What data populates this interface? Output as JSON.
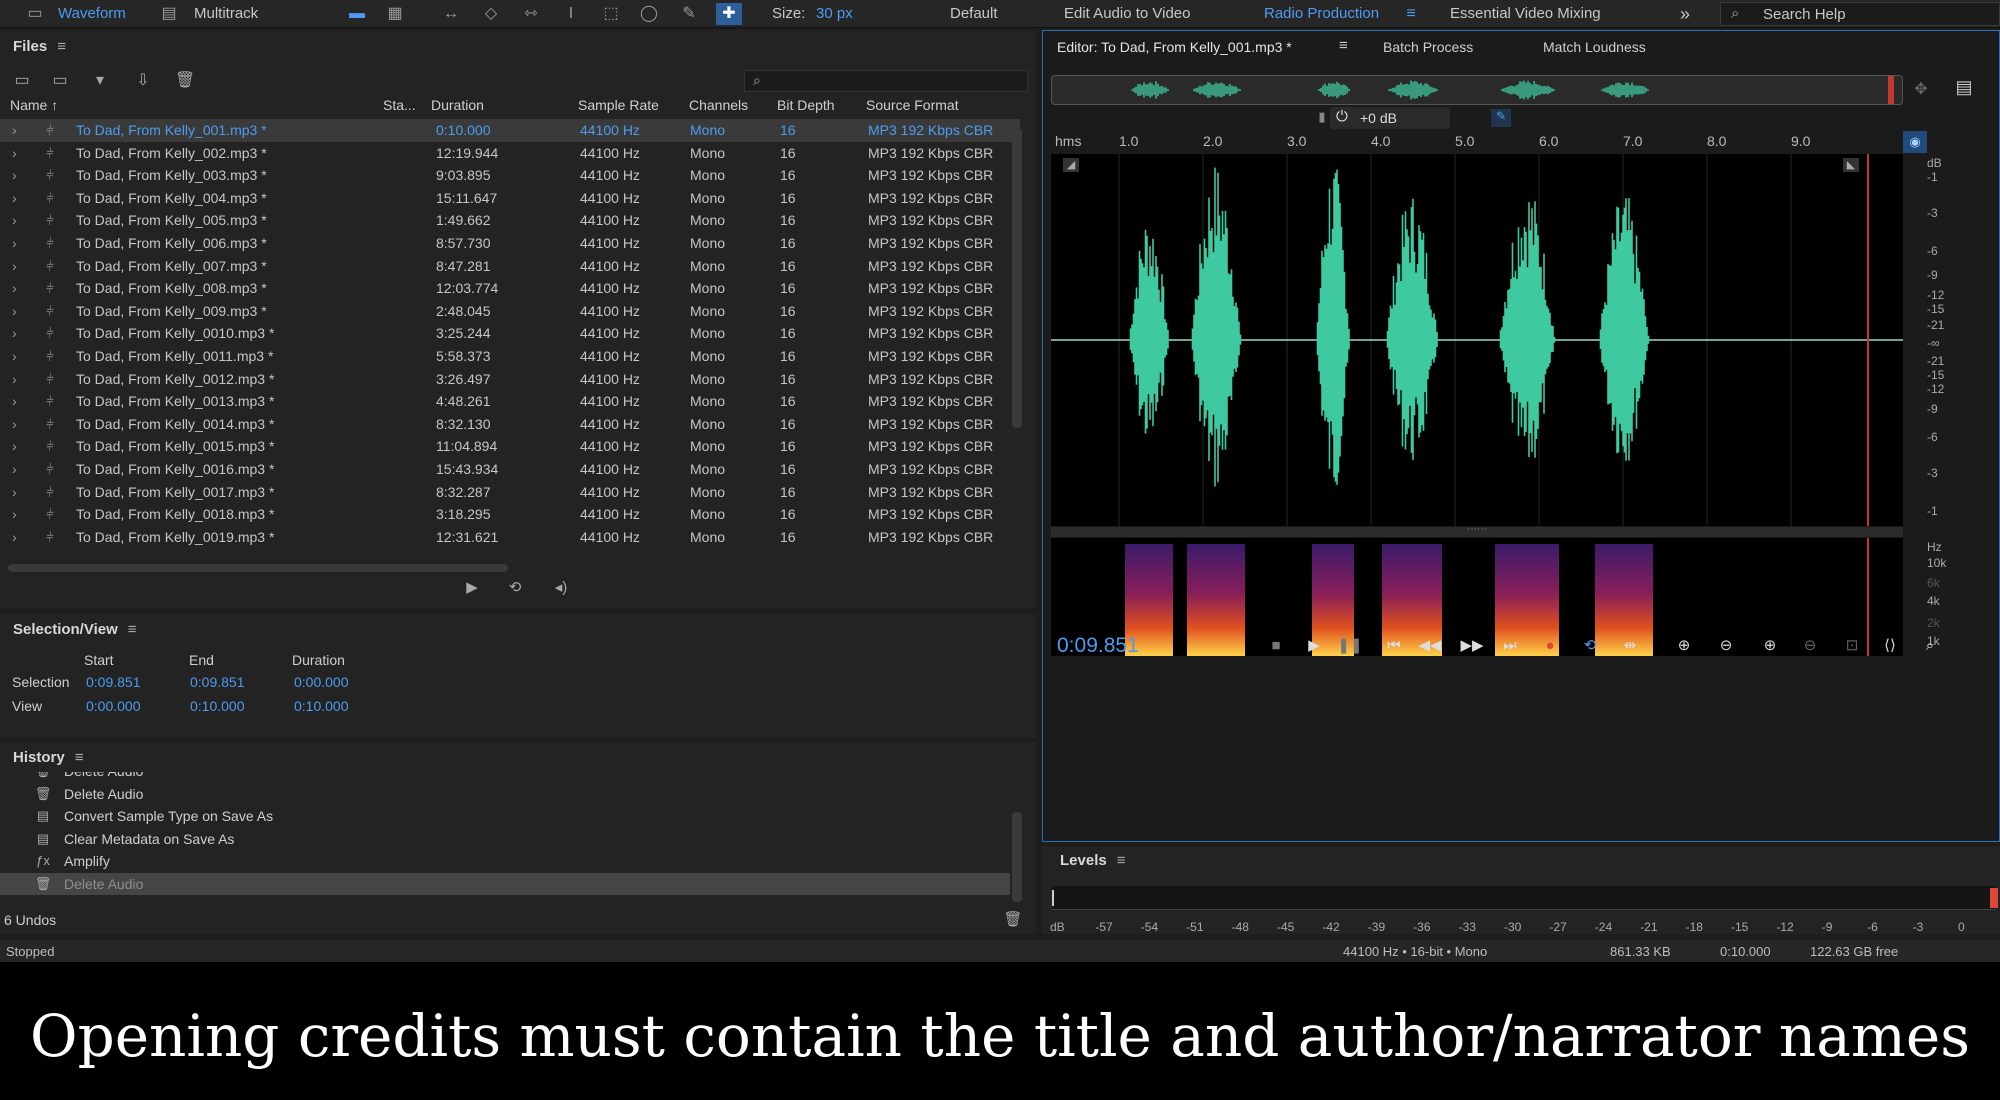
{
  "toolbar": {
    "waveform": "Waveform",
    "multitrack": "Multitrack",
    "size_label": "Size:",
    "size_value": "30 px",
    "workspaces": [
      "Default",
      "Edit Audio to Video",
      "Radio Production",
      "Essential Video Mixing"
    ],
    "active_workspace": "Radio Production",
    "more": "»",
    "search_placeholder": "Search Help"
  },
  "files": {
    "title": "Files",
    "columns": [
      "Name",
      "Sta...",
      "Duration",
      "Sample Rate",
      "Channels",
      "Bit Depth",
      "Source Format"
    ],
    "rows": [
      {
        "name": "To Dad, From Kelly_001.mp3 *",
        "duration": "0:10.000",
        "rate": "44100 Hz",
        "channels": "Mono",
        "depth": "16",
        "format": "MP3 192 Kbps CBR"
      },
      {
        "name": "To Dad, From Kelly_002.mp3 *",
        "duration": "12:19.944",
        "rate": "44100 Hz",
        "channels": "Mono",
        "depth": "16",
        "format": "MP3 192 Kbps CBR"
      },
      {
        "name": "To Dad, From Kelly_003.mp3 *",
        "duration": "9:03.895",
        "rate": "44100 Hz",
        "channels": "Mono",
        "depth": "16",
        "format": "MP3 192 Kbps CBR"
      },
      {
        "name": "To Dad, From Kelly_004.mp3 *",
        "duration": "15:11.647",
        "rate": "44100 Hz",
        "channels": "Mono",
        "depth": "16",
        "format": "MP3 192 Kbps CBR"
      },
      {
        "name": "To Dad, From Kelly_005.mp3 *",
        "duration": "1:49.662",
        "rate": "44100 Hz",
        "channels": "Mono",
        "depth": "16",
        "format": "MP3 192 Kbps CBR"
      },
      {
        "name": "To Dad, From Kelly_006.mp3 *",
        "duration": "8:57.730",
        "rate": "44100 Hz",
        "channels": "Mono",
        "depth": "16",
        "format": "MP3 192 Kbps CBR"
      },
      {
        "name": "To Dad, From Kelly_007.mp3 *",
        "duration": "8:47.281",
        "rate": "44100 Hz",
        "channels": "Mono",
        "depth": "16",
        "format": "MP3 192 Kbps CBR"
      },
      {
        "name": "To Dad, From Kelly_008.mp3 *",
        "duration": "12:03.774",
        "rate": "44100 Hz",
        "channels": "Mono",
        "depth": "16",
        "format": "MP3 192 Kbps CBR"
      },
      {
        "name": "To Dad, From Kelly_009.mp3 *",
        "duration": "2:48.045",
        "rate": "44100 Hz",
        "channels": "Mono",
        "depth": "16",
        "format": "MP3 192 Kbps CBR"
      },
      {
        "name": "To Dad, From Kelly_0010.mp3 *",
        "duration": "3:25.244",
        "rate": "44100 Hz",
        "channels": "Mono",
        "depth": "16",
        "format": "MP3 192 Kbps CBR"
      },
      {
        "name": "To Dad, From Kelly_0011.mp3 *",
        "duration": "5:58.373",
        "rate": "44100 Hz",
        "channels": "Mono",
        "depth": "16",
        "format": "MP3 192 Kbps CBR"
      },
      {
        "name": "To Dad, From Kelly_0012.mp3 *",
        "duration": "3:26.497",
        "rate": "44100 Hz",
        "channels": "Mono",
        "depth": "16",
        "format": "MP3 192 Kbps CBR"
      },
      {
        "name": "To Dad, From Kelly_0013.mp3 *",
        "duration": "4:48.261",
        "rate": "44100 Hz",
        "channels": "Mono",
        "depth": "16",
        "format": "MP3 192 Kbps CBR"
      },
      {
        "name": "To Dad, From Kelly_0014.mp3 *",
        "duration": "8:32.130",
        "rate": "44100 Hz",
        "channels": "Mono",
        "depth": "16",
        "format": "MP3 192 Kbps CBR"
      },
      {
        "name": "To Dad, From Kelly_0015.mp3 *",
        "duration": "11:04.894",
        "rate": "44100 Hz",
        "channels": "Mono",
        "depth": "16",
        "format": "MP3 192 Kbps CBR"
      },
      {
        "name": "To Dad, From Kelly_0016.mp3 *",
        "duration": "15:43.934",
        "rate": "44100 Hz",
        "channels": "Mono",
        "depth": "16",
        "format": "MP3 192 Kbps CBR"
      },
      {
        "name": "To Dad, From Kelly_0017.mp3 *",
        "duration": "8:32.287",
        "rate": "44100 Hz",
        "channels": "Mono",
        "depth": "16",
        "format": "MP3 192 Kbps CBR"
      },
      {
        "name": "To Dad, From Kelly_0018.mp3 *",
        "duration": "3:18.295",
        "rate": "44100 Hz",
        "channels": "Mono",
        "depth": "16",
        "format": "MP3 192 Kbps CBR"
      },
      {
        "name": "To Dad, From Kelly_0019.mp3 *",
        "duration": "12:31.621",
        "rate": "44100 Hz",
        "channels": "Mono",
        "depth": "16",
        "format": "MP3 192 Kbps CBR"
      }
    ]
  },
  "selection_view": {
    "title": "Selection/View",
    "headers": [
      "Start",
      "End",
      "Duration"
    ],
    "selection_label": "Selection",
    "selection": [
      "0:09.851",
      "0:09.851",
      "0:00.000"
    ],
    "view_label": "View",
    "view": [
      "0:00.000",
      "0:10.000",
      "0:10.000"
    ]
  },
  "history": {
    "title": "History",
    "items": [
      {
        "label": "Delete Audio",
        "icon": "trash-icon"
      },
      {
        "label": "Delete Audio",
        "icon": "trash-icon"
      },
      {
        "label": "Convert Sample Type on Save As",
        "icon": "list-icon"
      },
      {
        "label": "Clear Metadata on Save As",
        "icon": "list-icon"
      },
      {
        "label": "Amplify",
        "icon": "fx-icon"
      },
      {
        "label": "Delete Audio",
        "icon": "trash-icon"
      }
    ],
    "undos": "6 Undos"
  },
  "editor": {
    "tabs": [
      "Editor: To Dad, From Kelly_001.mp3 *",
      "Batch Process",
      "Match Loudness"
    ],
    "gain": "+0 dB",
    "ruler": [
      "hms",
      "1.0",
      "2.0",
      "3.0",
      "4.0",
      "5.0",
      "6.0",
      "7.0",
      "8.0",
      "9.0"
    ],
    "db_scale": [
      "dB",
      "-1",
      "-3",
      "-6",
      "-9",
      "-12",
      "-15",
      "-21",
      "-∞",
      "-21",
      "-15",
      "-12",
      "-9",
      "-6",
      "-3",
      "-1"
    ],
    "hz_scale": [
      "Hz",
      "10k",
      "6k",
      "4k",
      "2k",
      "1k"
    ],
    "time": "0:09.851",
    "wave_color": "#3ec9a0"
  },
  "levels": {
    "title": "Levels",
    "scale": [
      "dB",
      "-57",
      "-54",
      "-51",
      "-48",
      "-45",
      "-42",
      "-39",
      "-36",
      "-33",
      "-30",
      "-27",
      "-24",
      "-21",
      "-18",
      "-15",
      "-12",
      "-9",
      "-6",
      "-3",
      "0"
    ]
  },
  "status": {
    "left": "Stopped",
    "format": "44100 Hz • 16-bit • Mono",
    "size": "861.33 KB",
    "duration": "0:10.000",
    "free": "122.63 GB free"
  },
  "caption": "Opening credits must contain the title and author/narrator names"
}
